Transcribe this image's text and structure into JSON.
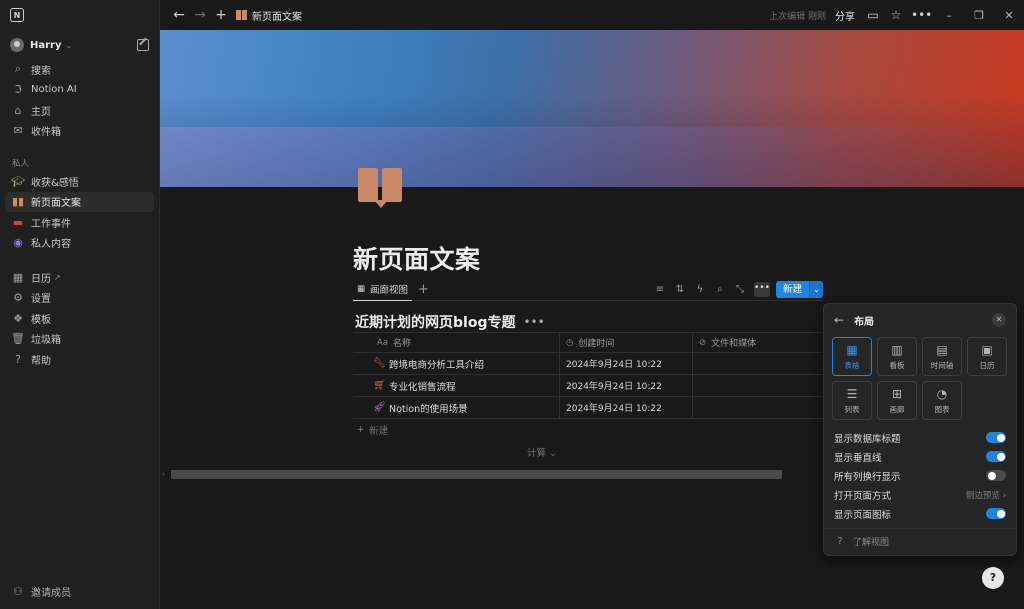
{
  "sidebar": {
    "workspace": "Harry",
    "top_items": [
      {
        "label": "搜索",
        "icon": "search-icon"
      },
      {
        "label": "Notion AI",
        "icon": "ai-icon"
      },
      {
        "label": "主页",
        "icon": "home-icon"
      },
      {
        "label": "收件箱",
        "icon": "inbox-icon"
      }
    ],
    "private_label": "私人",
    "private_items": [
      {
        "label": "收获&感悟",
        "icon": "graduation-cap-icon"
      },
      {
        "label": "新页面文案",
        "icon": "book-icon"
      },
      {
        "label": "工作事件",
        "icon": "laptop-icon"
      },
      {
        "label": "私人内容",
        "icon": "gamepad-icon"
      }
    ],
    "bottom_items": [
      {
        "label": "日历",
        "icon": "calendar-icon"
      },
      {
        "label": "设置",
        "icon": "gear-icon"
      },
      {
        "label": "模板",
        "icon": "template-icon"
      },
      {
        "label": "垃圾箱",
        "icon": "trash-icon"
      },
      {
        "label": "帮助",
        "icon": "help-icon"
      }
    ],
    "invite": "邀请成员"
  },
  "topbar": {
    "breadcrumb": "新页面文案",
    "edited": "上次编辑 刚刚",
    "share": "分享"
  },
  "page": {
    "title": "新页面文案",
    "view_tab": "画廊视图",
    "new_button": "新建",
    "db_title": "近期计划的网页blog专题",
    "columns": [
      "名称",
      "创建时间",
      "文件和媒体"
    ],
    "column_prefix": "Aa",
    "rows": [
      {
        "name": "跨境电商分析工具介绍",
        "created": "2024年9月24日 10:22",
        "icon": "wrench-icon"
      },
      {
        "name": "专业化销售流程",
        "created": "2024年9月24日 10:22",
        "icon": "cart-icon"
      },
      {
        "name": "Notion的使用场景",
        "created": "2024年9月24日 10:22",
        "icon": "rocket-icon"
      }
    ],
    "new_row": "新建",
    "calc": "计算"
  },
  "panel": {
    "title": "布局",
    "layouts": [
      "表格",
      "看板",
      "时间轴",
      "日历",
      "列表",
      "画廊",
      "图表"
    ],
    "selected_layout": "表格",
    "options": [
      {
        "label": "显示数据库标题",
        "toggle": true
      },
      {
        "label": "显示垂直线",
        "toggle": true
      },
      {
        "label": "所有列换行显示",
        "toggle": false
      },
      {
        "label": "打开页面方式",
        "value": "侧边预览"
      },
      {
        "label": "显示页面图标",
        "toggle": true
      }
    ],
    "help": "了解视图"
  },
  "colors": {
    "accent": "#2383e2",
    "page_icon": "#c98866",
    "background": "#191919",
    "sidebar": "#202020"
  }
}
